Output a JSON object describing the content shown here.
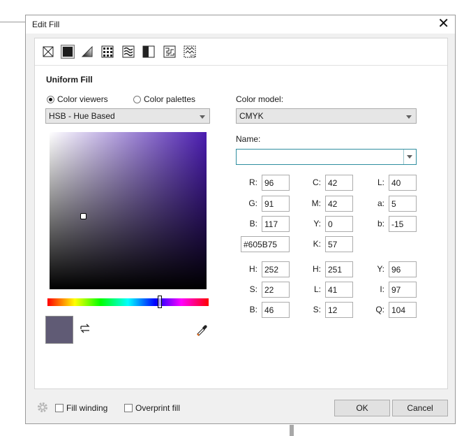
{
  "window": {
    "title": "Edit Fill",
    "close_glyph": "✕"
  },
  "fill_types": [
    "no-fill-icon",
    "uniform-fill-icon",
    "fountain-fill-icon",
    "vector-pattern-fill-icon",
    "bitmap-pattern-fill-icon",
    "two-color-pattern-fill-icon",
    "texture-fill-icon",
    "postscript-fill-icon"
  ],
  "heading": "Uniform Fill",
  "view_mode": {
    "viewers_label": "Color viewers",
    "palettes_label": "Color palettes",
    "selected": "viewers"
  },
  "viewer_select": {
    "value": "HSB - Hue Based"
  },
  "color_model": {
    "label": "Color model:",
    "value": "CMYK"
  },
  "name_field": {
    "label": "Name:",
    "value": ""
  },
  "values": {
    "rgb": {
      "R": "96",
      "G": "91",
      "B": "117"
    },
    "cmyk": {
      "C": "42",
      "M": "42",
      "Y": "0",
      "K": "57"
    },
    "lab": {
      "L": "40",
      "a": "5",
      "b": "-15"
    },
    "hex": "#605B75",
    "hsb": {
      "H": "252",
      "S": "22",
      "B": "46"
    },
    "hls": {
      "H": "251",
      "L": "41",
      "S": "12"
    },
    "yiq": {
      "Y": "96",
      "I": "97",
      "Q": "104"
    }
  },
  "swatch_color": "#605B75",
  "hue_fraction": 0.7,
  "picker_saturation": 0.22,
  "picker_brightness": 0.46,
  "bottom": {
    "fill_winding": "Fill winding",
    "overprint_fill": "Overprint fill",
    "ok": "OK",
    "cancel": "Cancel"
  },
  "icons": {
    "settings": "gear-icon",
    "swap": "swap-icon",
    "eyedropper": "eyedropper-icon"
  }
}
